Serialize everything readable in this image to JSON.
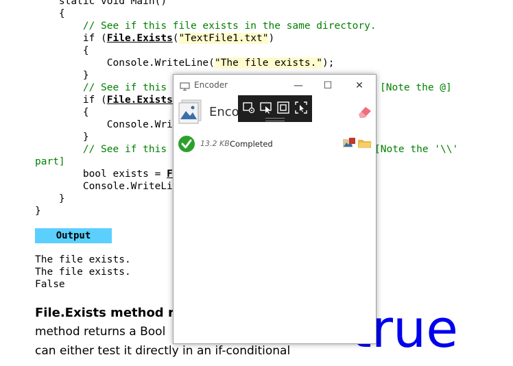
{
  "code": {
    "lines": [
      "    static void Main()",
      "    {",
      "        // See if this file exists in the same directory.",
      "        if (",
      "        {",
      "            Console.WriteLine(",
      "        }",
      "        // See if this",
      "        if (",
      "        {",
      "            Console.Wri",
      "        }",
      "        // See if this",
      "part]",
      "        bool exists = ",
      "        Console.WriteLi",
      "    }",
      "}"
    ],
    "file_exists_kw": "File.Exists",
    "file_exists_arg": "\"TextFile1.txt\"",
    "file_exists_close": ")",
    "writeline_arg": "\"The file exists.\"",
    "writeline_close": ");",
    "note_at": "[Note the @]",
    "note_backslash": "[Note the '\\\\'",
    "bool_partial": "F"
  },
  "output": {
    "label": "Output",
    "lines": [
      "The file exists.",
      "The file exists.",
      "False"
    ]
  },
  "article": {
    "heading": "File.Exists method re",
    "para1": "method returns a Bool",
    "para2": "can either test it directly in an if-conditional",
    "big_word": "true"
  },
  "encoder": {
    "window_title": "Encoder",
    "app_name": "Encod",
    "controls": {
      "minimize": "—",
      "maximize": "☐",
      "close": "✕"
    },
    "item": {
      "size": "13.2 KB",
      "status": "Completed"
    },
    "colors": {
      "toolbar": "#1f1f1f",
      "check": "#2ca02c",
      "eraser": "#f06b7f"
    }
  }
}
